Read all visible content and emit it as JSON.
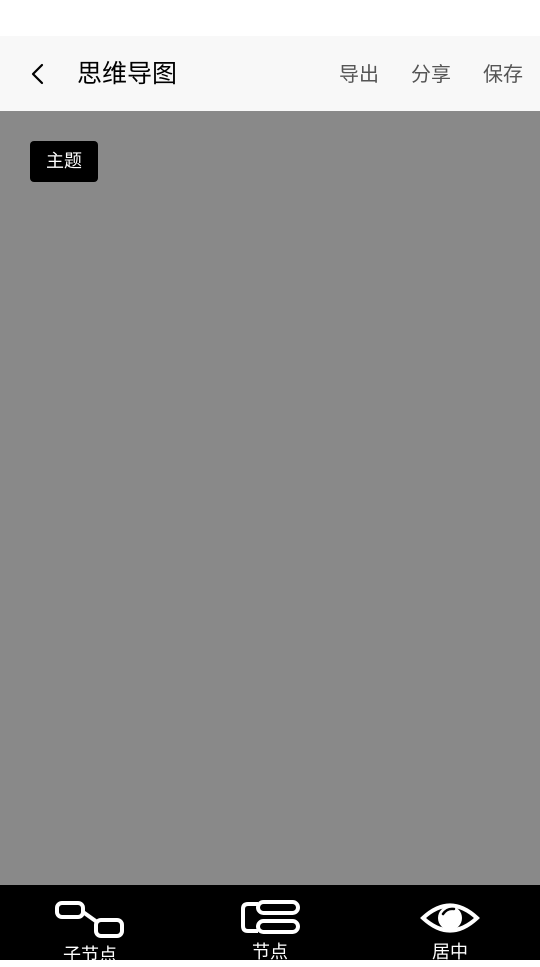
{
  "header": {
    "title": "思维导图",
    "actions": {
      "export": "导出",
      "share": "分享",
      "save": "保存"
    }
  },
  "canvas": {
    "root_topic": "主题",
    "background": "#898989"
  },
  "toolbar": {
    "child_node": "子节点",
    "sibling_node": "节点",
    "center": "居中"
  },
  "icons": {
    "back": "chevron-left-icon",
    "child_node": "child-node-icon",
    "sibling_node": "sibling-node-icon",
    "center": "eye-icon"
  }
}
